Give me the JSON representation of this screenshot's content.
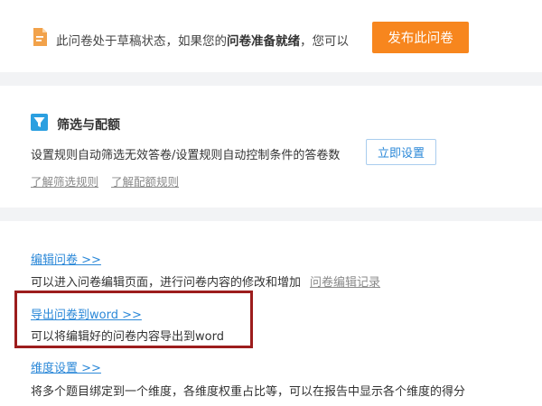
{
  "draft": {
    "message_prefix": "此问卷处于草稿状态，如果您的",
    "message_bold": "问卷准备就绪",
    "message_suffix": "，您可以",
    "publish_label": "发布此问卷"
  },
  "filter": {
    "title": "筛选与配额",
    "description": "设置规则自动筛选无效答卷/设置规则自动控制条件的答卷数",
    "setup_label": "立即设置",
    "links": [
      "了解筛选规则",
      "了解配额规则"
    ]
  },
  "actions": {
    "edit": {
      "link": "编辑问卷 >>",
      "description": "可以进入问卷编辑页面，进行问卷内容的修改和增加",
      "history": "问卷编辑记录"
    },
    "export": {
      "link": "导出问卷到word >>",
      "description": "可以将编辑好的问卷内容导出到word"
    },
    "dimension": {
      "link": "维度设置 >>",
      "description": "将多个题目绑定到一个维度，各维度权重占比等，可以在报告中显示各个维度的得分"
    }
  },
  "colors": {
    "accent_orange": "#f7861e",
    "link_blue": "#2b88d8",
    "highlight_red": "#9c1d1d"
  },
  "icons": {
    "draft": "document-icon",
    "filter": "funnel-icon"
  }
}
